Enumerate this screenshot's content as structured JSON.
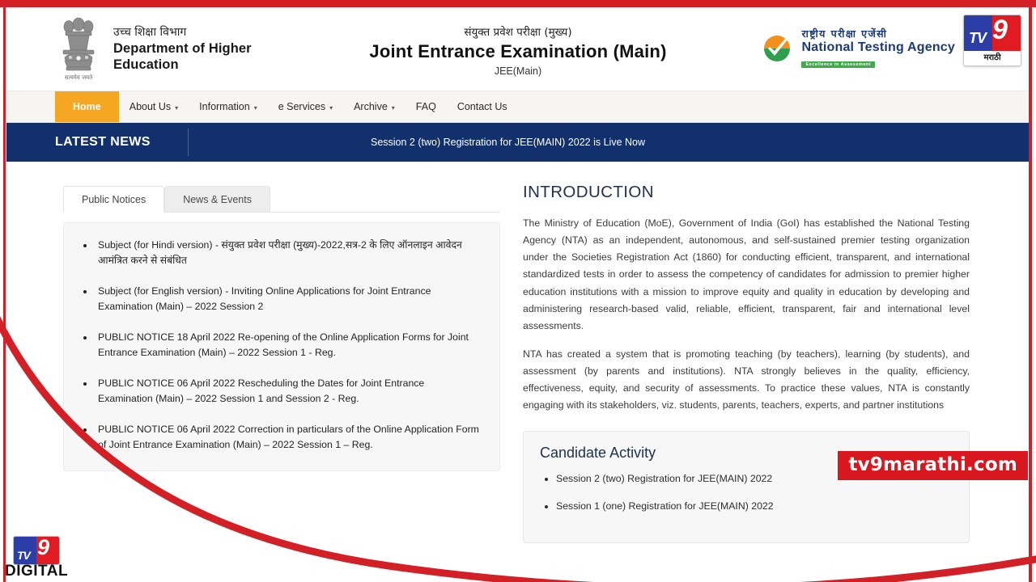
{
  "frame": {
    "accent_color": "#d31f26",
    "watermark": "tv9marathi.com",
    "bottom_logo_word": "DIGITAL"
  },
  "header": {
    "emblem_caption": "सत्यमेव जयते",
    "dept_hindi": "उच्च शिक्षा विभाग",
    "dept_english_line1": "Department of Higher",
    "dept_english_line2": "Education",
    "exam_hindi": "संयुक्त प्रवेश परीक्षा (मुख्य)",
    "exam_english": "Joint Entrance Examination (Main)",
    "exam_short": "JEE(Main)",
    "nta_hindi": "राष्ट्रीय  परीक्षा  एजेंसी",
    "nta_english": "National Testing Agency",
    "nta_tagline": "Excellence in Assessment",
    "channel_logo": {
      "tv": "TV",
      "nine": "9",
      "language": "मराठी"
    }
  },
  "nav": {
    "items": [
      {
        "label": "Home",
        "has_dropdown": false,
        "active": true
      },
      {
        "label": "About Us",
        "has_dropdown": true,
        "active": false
      },
      {
        "label": "Information",
        "has_dropdown": true,
        "active": false
      },
      {
        "label": "e Services",
        "has_dropdown": true,
        "active": false
      },
      {
        "label": "Archive",
        "has_dropdown": true,
        "active": false
      },
      {
        "label": "FAQ",
        "has_dropdown": false,
        "active": false
      },
      {
        "label": "Contact Us",
        "has_dropdown": false,
        "active": false
      }
    ],
    "active_bg_color": "#f5a623"
  },
  "news": {
    "label": "LATEST NEWS",
    "ticker": "Session 2 (two) Registration for JEE(MAIN) 2022 is Live Now",
    "bar_color": "#12306b"
  },
  "notices_panel": {
    "tabs": [
      {
        "label": "Public Notices",
        "active": true
      },
      {
        "label": "News & Events",
        "active": false
      }
    ],
    "items": [
      "Subject (for Hindi version) - संयुक्त प्रवेश परीक्षा (मुख्य)-2022,सत्र-2 के लिए ऑनलाइन आवेदन आमंत्रित करने से संबंधित",
      "Subject (for English version) - Inviting Online Applications for Joint Entrance Examination (Main) – 2022 Session 2",
      "PUBLIC NOTICE 18 April 2022 Re-opening of the Online Application Forms for Joint Entrance Examination (Main) – 2022 Session 1 - Reg.",
      "PUBLIC NOTICE 06 April 2022 Rescheduling the Dates for Joint Entrance Examination (Main) – 2022 Session 1 and Session 2 - Reg.",
      "PUBLIC NOTICE 06 April 2022 Correction in particulars of the Online Application Form of Joint Entrance Examination (Main) – 2022 Session 1 – Reg."
    ]
  },
  "introduction": {
    "title": "INTRODUCTION",
    "paragraph1": "The Ministry of Education (MoE), Government of India (GoI) has established the National Testing Agency (NTA) as an independent, autonomous, and self-sustained premier testing organization under the Societies Registration Act (1860) for conducting efficient, transparent, and international standardized tests in order to assess the competency of candidates for admission to premier higher education institutions with a mission to improve equity and quality in education by developing and administering research-based valid, reliable, efficient, transparent, fair and international level assessments.",
    "paragraph2": "NTA has created a system that is promoting teaching (by teachers), learning (by students), and assessment (by parents and institutions). NTA strongly believes in the quality, efficiency, effectiveness, equity, and security of assessments. To practice these values, NTA is constantly engaging with its stakeholders, viz. students, parents, teachers, experts, and partner institutions"
  },
  "candidate_activity": {
    "title": "Candidate Activity",
    "items": [
      "Session 2 (two) Registration for JEE(MAIN) 2022",
      "Session 1 (one) Registration for JEE(MAIN) 2022"
    ]
  }
}
